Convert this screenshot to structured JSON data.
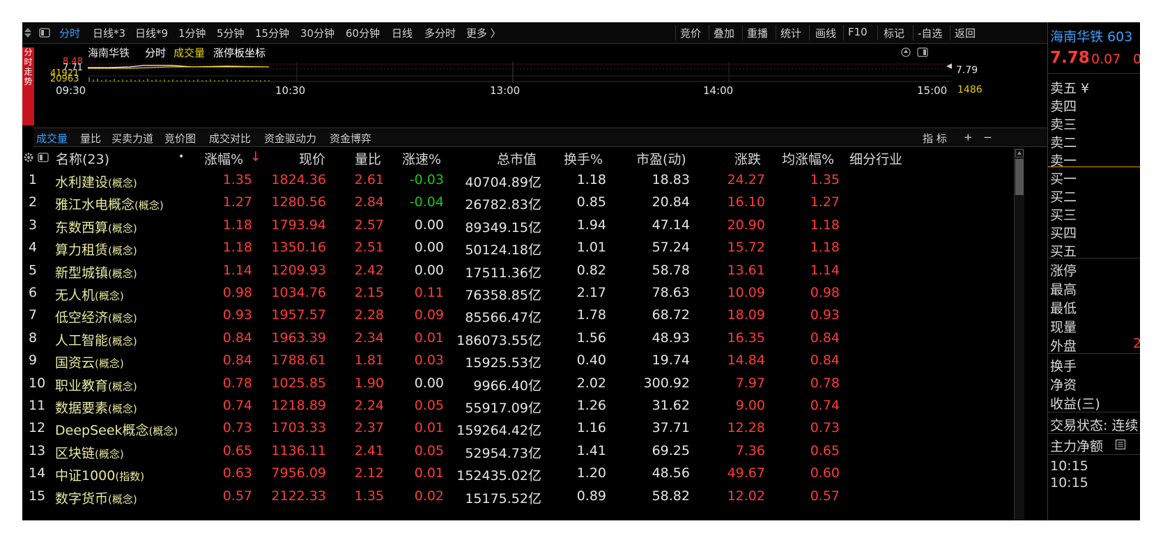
{
  "toolbar": {
    "left_items": [
      "分时",
      "日线*3",
      "日线*9",
      "1分钟",
      "5分钟",
      "15分钟",
      "30分钟",
      "60分钟",
      "日线",
      "多分时",
      "更多 〉"
    ],
    "right_items": [
      "竞价",
      "叠加",
      "重播",
      "统计",
      "画线",
      "F10",
      "标记",
      "-自选",
      "返回"
    ]
  },
  "side_strip": {
    "label": "分时走势"
  },
  "mini_chart": {
    "stock_name": "海南华铁",
    "mode": "分时",
    "volume_label": "成交量",
    "coord_label": "涨停板坐标",
    "price_top": "8.48",
    "price_mid": "7.71",
    "vol_a": "41921",
    "vol_b": "20963",
    "right_price": "7.79",
    "right_vol": "1486",
    "times": [
      "09:30",
      "10:30",
      "13:00",
      "14:00",
      "15:00"
    ]
  },
  "subtabs": {
    "items": [
      "成交量",
      "量比",
      "买卖力道",
      "竞价图",
      "成交对比",
      "资金驱动力",
      "资金博弈"
    ],
    "right_label": "指 标",
    "plus": "+",
    "minus": "−"
  },
  "table": {
    "headers": {
      "name": "名称(23)",
      "dot": "•",
      "change_pct": "涨幅%",
      "sort_arrow": "↓",
      "price": "现价",
      "vol_ratio": "量比",
      "speed": "涨速%",
      "mkt_cap": "总市值",
      "turnover": "换手%",
      "pe": "市盈(动)",
      "change": "涨跌",
      "avg_change": "均涨幅%",
      "industry": "细分行业"
    },
    "rows": [
      {
        "idx": "1",
        "name": "水利建设",
        "tag": "(概念)",
        "pct": "1.35",
        "price": "1824.36",
        "ratio": "2.61",
        "speed": "-0.03",
        "cap": "40704.89亿",
        "turn": "1.18",
        "pe": "18.83",
        "chg": "24.27",
        "avg": "1.35"
      },
      {
        "idx": "2",
        "name": "雅江水电概念",
        "tag": "(概念)",
        "pct": "1.27",
        "price": "1280.56",
        "ratio": "2.84",
        "speed": "-0.04",
        "cap": "26782.83亿",
        "turn": "0.85",
        "pe": "20.84",
        "chg": "16.10",
        "avg": "1.27"
      },
      {
        "idx": "3",
        "name": "东数西算",
        "tag": "(概念)",
        "pct": "1.18",
        "price": "1793.94",
        "ratio": "2.57",
        "speed": "0.00",
        "cap": "89349.15亿",
        "turn": "1.94",
        "pe": "47.14",
        "chg": "20.90",
        "avg": "1.18"
      },
      {
        "idx": "4",
        "name": "算力租赁",
        "tag": "(概念)",
        "pct": "1.18",
        "price": "1350.16",
        "ratio": "2.51",
        "speed": "0.00",
        "cap": "50124.18亿",
        "turn": "1.01",
        "pe": "57.24",
        "chg": "15.72",
        "avg": "1.18"
      },
      {
        "idx": "5",
        "name": "新型城镇",
        "tag": "(概念)",
        "pct": "1.14",
        "price": "1209.93",
        "ratio": "2.42",
        "speed": "0.00",
        "cap": "17511.36亿",
        "turn": "0.82",
        "pe": "58.78",
        "chg": "13.61",
        "avg": "1.14"
      },
      {
        "idx": "6",
        "name": "无人机",
        "tag": "(概念)",
        "pct": "0.98",
        "price": "1034.76",
        "ratio": "2.15",
        "speed": "0.11",
        "cap": "76358.85亿",
        "turn": "2.17",
        "pe": "78.63",
        "chg": "10.09",
        "avg": "0.98"
      },
      {
        "idx": "7",
        "name": "低空经济",
        "tag": "(概念)",
        "pct": "0.93",
        "price": "1957.57",
        "ratio": "2.28",
        "speed": "0.09",
        "cap": "85566.47亿",
        "turn": "1.78",
        "pe": "68.72",
        "chg": "18.09",
        "avg": "0.93"
      },
      {
        "idx": "8",
        "name": "人工智能",
        "tag": "(概念)",
        "pct": "0.84",
        "price": "1963.39",
        "ratio": "2.34",
        "speed": "0.01",
        "cap": "186073.55亿",
        "turn": "1.56",
        "pe": "48.93",
        "chg": "16.35",
        "avg": "0.84"
      },
      {
        "idx": "9",
        "name": "国资云",
        "tag": "(概念)",
        "pct": "0.84",
        "price": "1788.61",
        "ratio": "1.81",
        "speed": "0.03",
        "cap": "15925.53亿",
        "turn": "0.40",
        "pe": "19.74",
        "chg": "14.84",
        "avg": "0.84"
      },
      {
        "idx": "10",
        "name": "职业教育",
        "tag": "(概念)",
        "pct": "0.78",
        "price": "1025.85",
        "ratio": "1.90",
        "speed": "0.00",
        "cap": "9966.40亿",
        "turn": "2.02",
        "pe": "300.92",
        "chg": "7.97",
        "avg": "0.78"
      },
      {
        "idx": "11",
        "name": "数据要素",
        "tag": "(概念)",
        "pct": "0.74",
        "price": "1218.89",
        "ratio": "2.24",
        "speed": "0.05",
        "cap": "55917.09亿",
        "turn": "1.26",
        "pe": "31.62",
        "chg": "9.00",
        "avg": "0.74"
      },
      {
        "idx": "12",
        "name": "DeepSeek概念",
        "tag": "(概念)",
        "pct": "0.73",
        "price": "1703.33",
        "ratio": "2.37",
        "speed": "0.01",
        "cap": "159264.42亿",
        "turn": "1.16",
        "pe": "37.71",
        "chg": "12.28",
        "avg": "0.73"
      },
      {
        "idx": "13",
        "name": "区块链",
        "tag": "(概念)",
        "pct": "0.65",
        "price": "1136.11",
        "ratio": "2.41",
        "speed": "0.05",
        "cap": "52954.73亿",
        "turn": "1.41",
        "pe": "69.25",
        "chg": "7.36",
        "avg": "0.65"
      },
      {
        "idx": "14",
        "name": "中证1000",
        "tag": "(指数)",
        "pct": "0.63",
        "price": "7956.09",
        "ratio": "2.12",
        "speed": "0.01",
        "cap": "152435.02亿",
        "turn": "1.20",
        "pe": "48.56",
        "chg": "49.67",
        "avg": "0.60"
      },
      {
        "idx": "15",
        "name": "数字货币",
        "tag": "(概念)",
        "pct": "0.57",
        "price": "2122.33",
        "ratio": "1.35",
        "speed": "0.02",
        "cap": "15175.52亿",
        "turn": "0.89",
        "pe": "58.82",
        "chg": "12.02",
        "avg": "0.57"
      }
    ]
  },
  "right_panel": {
    "stock_title": "海南华铁 603",
    "price": "7.78",
    "change": "0.07",
    "change_cut": "0",
    "asks": [
      "卖五 ¥",
      "卖四",
      "卖三",
      "卖二",
      "卖一"
    ],
    "bids": [
      "买一",
      "买二",
      "买三",
      "买四",
      "买五"
    ],
    "stats": [
      "涨停",
      "最高",
      "最低",
      "现量",
      "外盘"
    ],
    "outer_cut": "2",
    "stats2": [
      "换手",
      "净资",
      "收益(三)"
    ],
    "status": "交易状态: 连续",
    "main_net": "主力净额",
    "times": [
      "10:15",
      "10:15"
    ]
  },
  "colors": {
    "up": "#ff3b3b",
    "down": "#19c819",
    "name": "#e8e8a0",
    "accent_blue": "#3ca0ff",
    "yellow": "#e6d200"
  }
}
